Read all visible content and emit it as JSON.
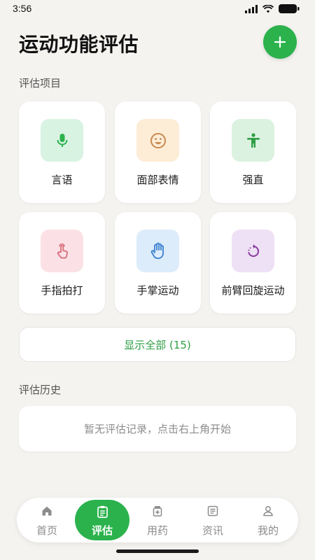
{
  "status_bar": {
    "time": "3:56"
  },
  "header": {
    "title": "运动功能评估",
    "add_icon": "plus-icon"
  },
  "sections": {
    "projects_label": "评估项目",
    "history_label": "评估历史"
  },
  "items": [
    {
      "label": "言语",
      "icon": "microphone-icon",
      "bg": "#d9f3e3",
      "color": "#2bb24c"
    },
    {
      "label": "面部表情",
      "icon": "smiley-icon",
      "bg": "#fdecd6",
      "color": "#c98a4f"
    },
    {
      "label": "强直",
      "icon": "person-icon",
      "bg": "#dcf2e0",
      "color": "#2e9e45"
    },
    {
      "label": "手指拍打",
      "icon": "finger-tap-icon",
      "bg": "#fbe1e6",
      "color": "#d76a78"
    },
    {
      "label": "手掌运动",
      "icon": "palm-icon",
      "bg": "#dcecfa",
      "color": "#3a7fd0"
    },
    {
      "label": "前臂回旋运动",
      "icon": "rotate-icon",
      "bg": "#eee0f5",
      "color": "#8a3f9e"
    }
  ],
  "show_all_label": "显示全部 (15)",
  "history_empty_text": "暂无评估记录，点击右上角开始",
  "nav": [
    {
      "label": "首页",
      "icon": "home-icon"
    },
    {
      "label": "评估",
      "icon": "clipboard-icon",
      "active": true
    },
    {
      "label": "用药",
      "icon": "medicine-icon"
    },
    {
      "label": "资讯",
      "icon": "news-icon"
    },
    {
      "label": "我的",
      "icon": "user-icon"
    }
  ],
  "colors": {
    "accent": "#2bb24c",
    "background": "#f4f3f0"
  }
}
